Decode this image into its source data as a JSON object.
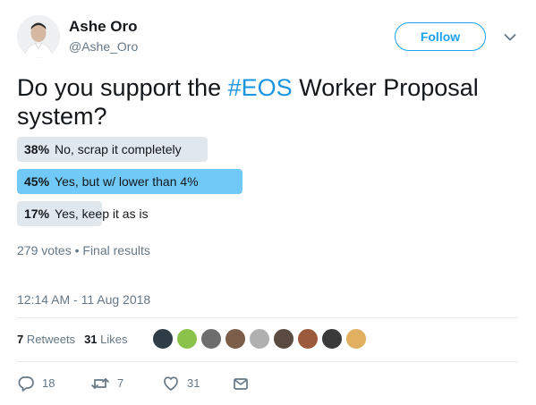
{
  "author": {
    "name": "Ashe Oro",
    "handle": "@Ashe_Oro"
  },
  "follow_button": {
    "label": "Follow"
  },
  "tweet": {
    "text_before": "Do you support the ",
    "hashtag": "#EOS",
    "text_after": " Worker Proposal system?"
  },
  "poll": {
    "options": [
      {
        "percent": "38%",
        "label": "No, scrap it completely",
        "fraction": 0.38,
        "winner": false
      },
      {
        "percent": "45%",
        "label": "Yes, but w/ lower than 4%",
        "fraction": 0.45,
        "winner": true
      },
      {
        "percent": "17%",
        "label": "Yes, keep it as is",
        "fraction": 0.17,
        "winner": false
      }
    ],
    "meta": "279 votes • Final results"
  },
  "timestamp": "12:14 AM - 11 Aug 2018",
  "stats": {
    "retweets_count": "7",
    "retweets_label": "Retweets",
    "likes_count": "31",
    "likes_label": "Likes"
  },
  "likers": [
    {
      "name": "liker-1",
      "color": "#2f3e46"
    },
    {
      "name": "liker-2",
      "color": "#8bc34a"
    },
    {
      "name": "liker-3",
      "color": "#6d6d6d"
    },
    {
      "name": "liker-4",
      "color": "#7b5e4a"
    },
    {
      "name": "liker-5",
      "color": "#b0b0b0"
    },
    {
      "name": "liker-6",
      "color": "#5a4a3f"
    },
    {
      "name": "liker-7",
      "color": "#9c5a3c"
    },
    {
      "name": "liker-8",
      "color": "#3a3a3a"
    },
    {
      "name": "liker-9",
      "color": "#e0b060"
    }
  ],
  "actions": {
    "replies": "18",
    "retweets": "7",
    "likes": "31"
  },
  "colors": {
    "accent": "#1da1f2",
    "hashtag": "#1b95e0",
    "winner_bar": "#71c9f8",
    "bar": "#e1e8ed",
    "muted_text": "#657786"
  },
  "icons": {
    "chevron": "chevron-down-icon",
    "reply": "reply-icon",
    "retweet": "retweet-icon",
    "like": "heart-icon",
    "message": "envelope-icon"
  }
}
